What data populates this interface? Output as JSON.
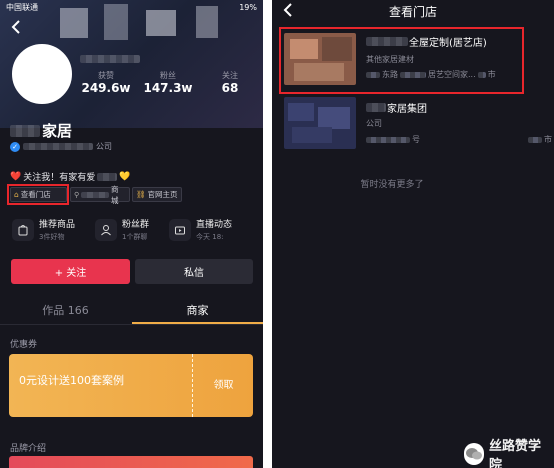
{
  "left": {
    "status": {
      "carrier": "中国联通",
      "battery": "19%"
    },
    "stats": [
      {
        "value": "249.6w",
        "label": "获赞"
      },
      {
        "value": "147.3w",
        "label": "粉丝"
      },
      {
        "value": "68",
        "label": "关注"
      }
    ],
    "profile": {
      "name_suffix": "家居",
      "company_suffix": "公司"
    },
    "bio": {
      "text": "关注我！有家有爱",
      "heart_red": "❤️",
      "heart_yellow": "💛"
    },
    "pills": {
      "store": "查看门店",
      "mall": "商城",
      "official": "官网主页"
    },
    "cards": [
      {
        "title": "推荐商品",
        "sub": "3件好物"
      },
      {
        "title": "粉丝群",
        "sub": "1个群聊"
      },
      {
        "title": "直播动态",
        "sub": "今天 18:"
      }
    ],
    "buttons": {
      "follow": "+ 关注",
      "message": "私信"
    },
    "tabs": {
      "works": "作品 166",
      "merchant": "商家"
    },
    "coupon": {
      "section": "优惠券",
      "text": "0元设计送100套案例",
      "claim": "领取"
    },
    "brand": {
      "section": "品牌介绍"
    }
  },
  "right": {
    "header": {
      "title": "查看门店"
    },
    "stores": [
      {
        "name_suffix": "全屋定制(居艺店)",
        "category": "其他家居建材",
        "addr_mid": "东路",
        "addr_end": "居艺空间家...",
        "dist": "市"
      },
      {
        "name_suffix": "家居集团",
        "category": "公司",
        "addr_end": "号",
        "dist": "市"
      }
    ],
    "no_more": "暂时没有更多了"
  },
  "watermark": {
    "text": "丝路赞学院"
  },
  "colors": {
    "bg": "#16161e",
    "follow_red": "#e8344e",
    "coupon_orange": "#f0ad48",
    "highlight_red": "#e8262c"
  }
}
